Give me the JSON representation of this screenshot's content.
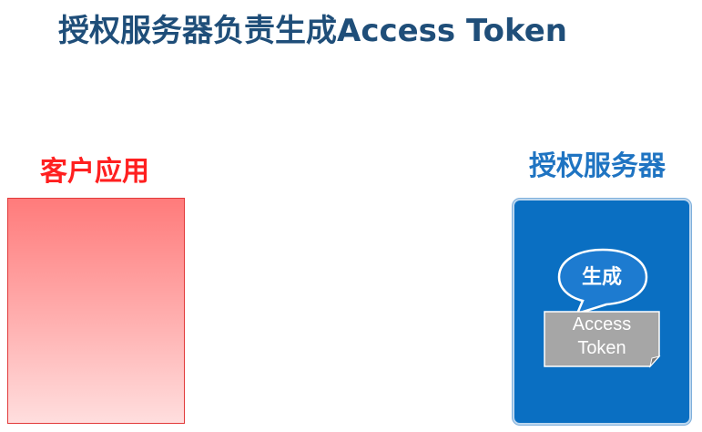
{
  "title": "授权服务器负责生成Access Token",
  "client": {
    "label": "客户应用"
  },
  "server": {
    "label": "授权服务器",
    "bubble_text": "生成",
    "token_line1": "Access",
    "token_line2": "Token"
  },
  "colors": {
    "title": "#1f4e79",
    "client_label": "#ff2020",
    "server_label": "#1f74c2",
    "server_box": "#0a6fc2",
    "bubble": "#1d7bd0",
    "token_note": "#a6a6a6"
  }
}
